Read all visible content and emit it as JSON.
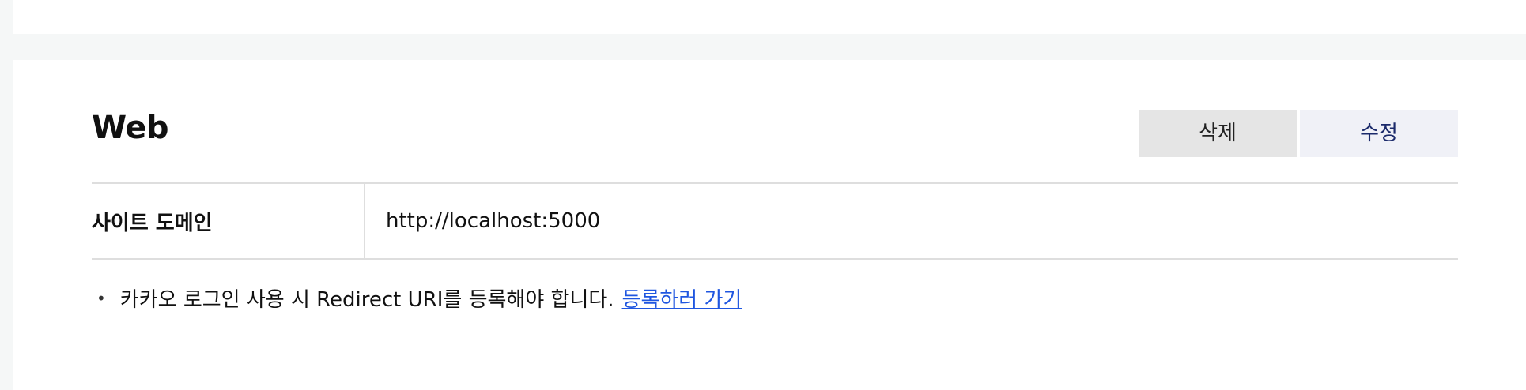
{
  "section": {
    "title": "Web"
  },
  "actions": {
    "delete_label": "삭제",
    "edit_label": "수정"
  },
  "site_domain": {
    "label": "사이트 도메인",
    "value": "http://localhost:5000"
  },
  "notice": {
    "bullet": "•",
    "text": "카카오 로그인 사용 시 Redirect URI를 등록해야 합니다.",
    "link_label": "등록하러 가기"
  },
  "colors": {
    "page_background": "#f5f7f7",
    "card_background": "#ffffff",
    "delete_button_bg": "#e5e5e5",
    "edit_button_bg": "#f0f1f7",
    "edit_button_text": "#1b2a6b",
    "link": "#1f56e0",
    "divider": "#dedede"
  }
}
